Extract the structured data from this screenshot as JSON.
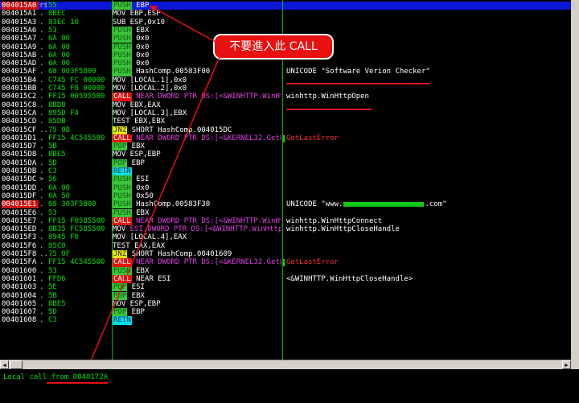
{
  "rows": [
    {
      "addr": "004015A0",
      "mark": "r$",
      "hex": "55",
      "mn": "PUSH",
      "mtype": "push",
      "ops": "EBP",
      "cmt": "",
      "cstyle": "",
      "sel": true,
      "addr_hl": true
    },
    {
      "addr": "004015A1",
      "mark": ".",
      "hex": "8BEC",
      "mn": "MOV",
      "mtype": "plain",
      "ops": "EBP,ESP",
      "cmt": "",
      "cstyle": ""
    },
    {
      "addr": "004015A3",
      "mark": ".",
      "hex": "83EC 10",
      "mn": "SUB",
      "mtype": "plain",
      "ops": "ESP,0x10",
      "cmt": "",
      "cstyle": ""
    },
    {
      "addr": "004015A6",
      "mark": ".",
      "hex": "53",
      "mn": "PUSH",
      "mtype": "push",
      "ops": "EBX",
      "cmt": "",
      "cstyle": ""
    },
    {
      "addr": "004015A7",
      "mark": ".",
      "hex": "6A 00",
      "mn": "PUSH",
      "mtype": "push",
      "ops": "0x0",
      "cmt": "",
      "cstyle": ""
    },
    {
      "addr": "004015A9",
      "mark": ".",
      "hex": "6A 00",
      "mn": "PUSH",
      "mtype": "push",
      "ops": "0x0",
      "cmt": "",
      "cstyle": ""
    },
    {
      "addr": "004015AB",
      "mark": ".",
      "hex": "6A 00",
      "mn": "PUSH",
      "mtype": "push",
      "ops": "0x0",
      "cmt": "",
      "cstyle": ""
    },
    {
      "addr": "004015AD",
      "mark": ".",
      "hex": "6A 00",
      "mn": "PUSH",
      "mtype": "push",
      "ops": "0x0",
      "cmt": "",
      "cstyle": ""
    },
    {
      "addr": "004015AF",
      "mark": ".",
      "hex": "68 003F5800",
      "mn": "PUSH",
      "mtype": "push",
      "ops": "HashComp.00583F00",
      "cmt": "UNICODE \"Software Verion Checker\"",
      "cstyle": ""
    },
    {
      "addr": "004015B4",
      "mark": ".",
      "hex": "C745 FC 00000",
      "mn": "MOV",
      "mtype": "plain",
      "ops": "[LOCAL.1],0x0",
      "cmt": "",
      "cstyle": ""
    },
    {
      "addr": "004015BB",
      "mark": ".",
      "hex": "C745 F8 00000",
      "mn": "MOV",
      "mtype": "plain",
      "ops": "[LOCAL.2],0x0",
      "cmt": "",
      "cstyle": ""
    },
    {
      "addr": "004015C2",
      "mark": ".",
      "hex": "FF15 00595500",
      "mn": "CALL",
      "mtype": "call",
      "ops": "NEAR DWORD PTR DS:[<&WINHTTP.WinHtt",
      "cmt": "winhttp.WinHttpOpen",
      "cstyle": ""
    },
    {
      "addr": "004015C8",
      "mark": ".",
      "hex": "8BD8",
      "mn": "MOV",
      "mtype": "plain",
      "ops": "EBX,EAX",
      "cmt": "",
      "cstyle": ""
    },
    {
      "addr": "004015CA",
      "mark": ".",
      "hex": "895D F4",
      "mn": "MOV",
      "mtype": "plain",
      "ops": "[LOCAL.3],EBX",
      "cmt": "",
      "cstyle": ""
    },
    {
      "addr": "004015CD",
      "mark": ".",
      "hex": "85DB",
      "mn": "TEST",
      "mtype": "plain",
      "ops": "EBX,EBX",
      "cmt": "",
      "cstyle": ""
    },
    {
      "addr": "004015CF",
      "mark": "..",
      "hex": "75 0B",
      "mn": "JNZ",
      "mtype": "jcc",
      "ops": "SHORT HashComp.004015DC",
      "cmt": "",
      "cstyle": ""
    },
    {
      "addr": "004015D1",
      "mark": ".",
      "hex": "FF15 4C545500",
      "mn": "CALL",
      "mtype": "call",
      "ops": "NEAR DWORD PTR DS:[<&KERNEL32.GetLa",
      "cmt": "GetLastError",
      "cstyle": "red"
    },
    {
      "addr": "004015D7",
      "mark": ".",
      "hex": "5B",
      "mn": "POP",
      "mtype": "push",
      "ops": "EBX",
      "cmt": "",
      "cstyle": ""
    },
    {
      "addr": "004015D8",
      "mark": ".",
      "hex": "8BE5",
      "mn": "MOV",
      "mtype": "plain",
      "ops": "ESP,EBP",
      "cmt": "",
      "cstyle": ""
    },
    {
      "addr": "004015DA",
      "mark": ".",
      "hex": "5D",
      "mn": "POP",
      "mtype": "push",
      "ops": "EBP",
      "cmt": "",
      "cstyle": ""
    },
    {
      "addr": "004015DB",
      "mark": ".",
      "hex": "C3",
      "mn": "RETN",
      "mtype": "ret",
      "ops": "",
      "cmt": "",
      "cstyle": ""
    },
    {
      "addr": "004015DC",
      "mark": ">",
      "hex": "56",
      "mn": "PUSH",
      "mtype": "push",
      "ops": "ESI",
      "cmt": "",
      "cstyle": ""
    },
    {
      "addr": "004015DD",
      "mark": ".",
      "hex": "6A 00",
      "mn": "PUSH",
      "mtype": "push",
      "ops": "0x0",
      "cmt": "",
      "cstyle": ""
    },
    {
      "addr": "004015DF",
      "mark": ".",
      "hex": "6A 50",
      "mn": "PUSH",
      "mtype": "push",
      "ops": "0x50",
      "cmt": "",
      "cstyle": ""
    },
    {
      "addr": "004015E1",
      "mark": ".",
      "hex": "68 303F5800",
      "mn": "PUSH",
      "mtype": "push",
      "ops": "HashComp.00583F30",
      "cmt": "UNICODE \"www.",
      "cmt_tail": ".com\"",
      "cstyle": "",
      "addr_hl": true,
      "redact": true
    },
    {
      "addr": "004015E6",
      "mark": ".",
      "hex": "53",
      "mn": "PUSH",
      "mtype": "push",
      "ops": "EBX",
      "cmt": "",
      "cstyle": ""
    },
    {
      "addr": "004015E7",
      "mark": ".",
      "hex": "FF15 F0585500",
      "mn": "CALL",
      "mtype": "call",
      "ops": "NEAR DWORD PTR DS:[<&WINHTTP.WinHtt",
      "cmt": "winhttp.WinHttpConnect",
      "cstyle": ""
    },
    {
      "addr": "004015ED",
      "mark": ".",
      "hex": "8B35 FC585500",
      "mn": "MOV",
      "mtype": "plain",
      "ops": "ESI,DWORD PTR DS:[<&WINHTTP.WinHttp(",
      "cmt": "winhttp.WinHttpCloseHandle",
      "cstyle": ""
    },
    {
      "addr": "004015F3",
      "mark": ".",
      "hex": "8945 F0",
      "mn": "MOV",
      "mtype": "plain",
      "ops": "[LOCAL.4],EAX",
      "cmt": "",
      "cstyle": ""
    },
    {
      "addr": "004015F6",
      "mark": ".",
      "hex": "85C0",
      "mn": "TEST",
      "mtype": "plain",
      "ops": "EAX,EAX",
      "cmt": "",
      "cstyle": ""
    },
    {
      "addr": "004015F8",
      "mark": "..",
      "hex": "75 0F",
      "mn": "JNZ",
      "mtype": "jcc",
      "ops": "SHORT HashComp.00401609",
      "cmt": "",
      "cstyle": ""
    },
    {
      "addr": "004015FA",
      "mark": ".",
      "hex": "FF15 4C545500",
      "mn": "CALL",
      "mtype": "call",
      "ops": "NEAR DWORD PTR DS:[<&KERNEL32.GetLa",
      "cmt": "GetLastError",
      "cstyle": "red"
    },
    {
      "addr": "00401600",
      "mark": ".",
      "hex": "53",
      "mn": "PUSH",
      "mtype": "push",
      "ops": "EBX",
      "cmt": "",
      "cstyle": ""
    },
    {
      "addr": "00401601",
      "mark": ".",
      "hex": "FFD6",
      "mn": "CALL",
      "mtype": "call",
      "ops": "NEAR ESI",
      "cmt": "<&WINHTTP.WinHttpCloseHandle>",
      "cstyle": ""
    },
    {
      "addr": "00401603",
      "mark": ".",
      "hex": "5E",
      "mn": "POP",
      "mtype": "push",
      "ops": "ESI",
      "cmt": "",
      "cstyle": ""
    },
    {
      "addr": "00401604",
      "mark": ".",
      "hex": "5B",
      "mn": "POP",
      "mtype": "push",
      "ops": "EBX",
      "cmt": "",
      "cstyle": ""
    },
    {
      "addr": "00401605",
      "mark": ".",
      "hex": "8BE5",
      "mn": "MOV",
      "mtype": "plain",
      "ops": "ESP,EBP",
      "cmt": "",
      "cstyle": ""
    },
    {
      "addr": "00401607",
      "mark": ".",
      "hex": "5D",
      "mn": "POP",
      "mtype": "push",
      "ops": "EBP",
      "cmt": "",
      "cstyle": ""
    },
    {
      "addr": "00401608",
      "mark": ".",
      "hex": "C3",
      "mn": "RETN",
      "mtype": "ret",
      "ops": "",
      "cmt": "",
      "cstyle": ""
    }
  ],
  "callout_text": "不要進入此 CALL",
  "status_text": "Local call from 0040172A",
  "colors": {
    "accent_red": "#e81010",
    "selection_blue": "#0a18d8",
    "push_green": "#3ac43a",
    "retn_cyan": "#00e0e8",
    "jcc_yellow": "#e8e800",
    "hex_green": "#00e000",
    "redact_green": "#10c810"
  }
}
